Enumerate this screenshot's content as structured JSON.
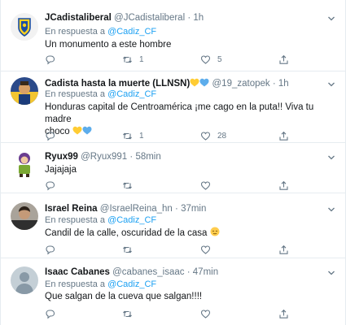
{
  "tweets": [
    {
      "name": "JCadistaliberal",
      "handle": "@JCadistaliberal",
      "dot": "·",
      "time": "1h",
      "reply_prefix": "En respuesta a",
      "reply_to": "@Cadiz_CF",
      "text": "Un monumento a este hombre",
      "reply_count": "",
      "retweet_count": "1",
      "like_count": "5",
      "avatar_icon": "cadiz-crest-avatar"
    },
    {
      "name": "Cadista hasta la muerte (LLNSN)",
      "handle": "@19_zatopek",
      "dot": "·",
      "time": "1h",
      "reply_prefix": "En respuesta a",
      "reply_to": "@Cadiz_CF",
      "text_line1": "Honduras capital de Centroamérica ¡me cago en la puta!! Viva tu madre",
      "text_line2": "choco",
      "reply_count": "",
      "retweet_count": "1",
      "like_count": "28",
      "avatar_icon": "yellow-blue-avatar",
      "name_emojis": [
        "yellow-heart-icon",
        "blue-heart-icon"
      ],
      "text_emojis": [
        "yellow-heart-icon",
        "blue-heart-icon"
      ]
    },
    {
      "name": "Ryux99",
      "handle": "@Ryux991",
      "dot": "·",
      "time": "58min",
      "text": "Jajajaja",
      "reply_count": "",
      "retweet_count": "",
      "like_count": "",
      "avatar_icon": "cartoon-character-avatar"
    },
    {
      "name": "Israel Reina",
      "handle": "@IsraelReina_hn",
      "dot": "·",
      "time": "37min",
      "reply_prefix": "En respuesta a",
      "reply_to": "@Cadiz_CF",
      "text": "Candil de la calle, oscuridad de la casa",
      "reply_count": "",
      "retweet_count": "",
      "like_count": "",
      "avatar_icon": "person-photo-avatar",
      "text_emojis": [
        "relieved-face-icon"
      ]
    },
    {
      "name": "Isaac Cabanes",
      "handle": "@cabanes_isaac",
      "dot": "·",
      "time": "47min",
      "reply_prefix": "En respuesta a",
      "reply_to": "@Cadiz_CF",
      "text": "Que salgan de la cueva que salgan!!!!",
      "reply_count": "",
      "retweet_count": "",
      "like_count": "",
      "avatar_icon": "default-profile-avatar"
    }
  ],
  "colors": {
    "link": "#1da1f2",
    "secondary_text": "#657786",
    "primary_text": "#14171a",
    "border": "#e6ecf0",
    "yellow_heart": "#ffcc33",
    "blue_heart": "#5dadec"
  }
}
